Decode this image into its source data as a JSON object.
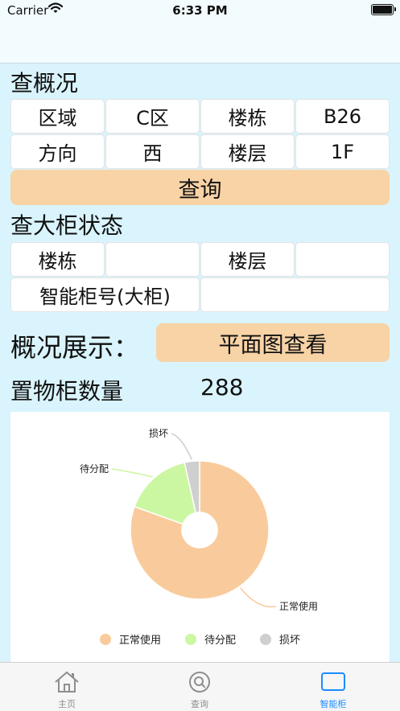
{
  "status_bar": {
    "carrier": "Carrier",
    "time": "6:33 PM"
  },
  "overview_query": {
    "title": "查概况",
    "area_label": "区域",
    "area_value": "C区",
    "building_label": "楼栋",
    "building_value": "B26",
    "direction_label": "方向",
    "direction_value": "西",
    "floor_label": "楼层",
    "floor_value": "1F",
    "query_button": "查询"
  },
  "cabinet_status": {
    "title": "查大柜状态",
    "building_label": "楼栋",
    "building_value": "",
    "floor_label": "楼层",
    "floor_value": "",
    "cabinet_no_label": "智能柜号(大柜)",
    "cabinet_no_value": ""
  },
  "overview_display": {
    "title": "概况展示：",
    "floor_plan_button": "平面图查看",
    "count_label": "置物柜数量",
    "count_value": "288"
  },
  "chart_data": {
    "type": "pie",
    "donut": true,
    "series": [
      {
        "name": "正常使用",
        "value": 0.805,
        "color": "#f9cb9c"
      },
      {
        "name": "待分配",
        "value": 0.16,
        "color": "#ccf7a2"
      },
      {
        "name": "损坏",
        "value": 0.035,
        "color": "#cfcfcf"
      }
    ],
    "legend_position": "bottom"
  },
  "tab_bar": {
    "tabs": [
      {
        "label": "主页",
        "icon": "home-icon"
      },
      {
        "label": "查询",
        "icon": "search-icon"
      },
      {
        "label": "智能柜",
        "icon": "cabinet-icon"
      }
    ],
    "active_color": "#1a8cff",
    "inactive_color": "#8e8e8e"
  }
}
